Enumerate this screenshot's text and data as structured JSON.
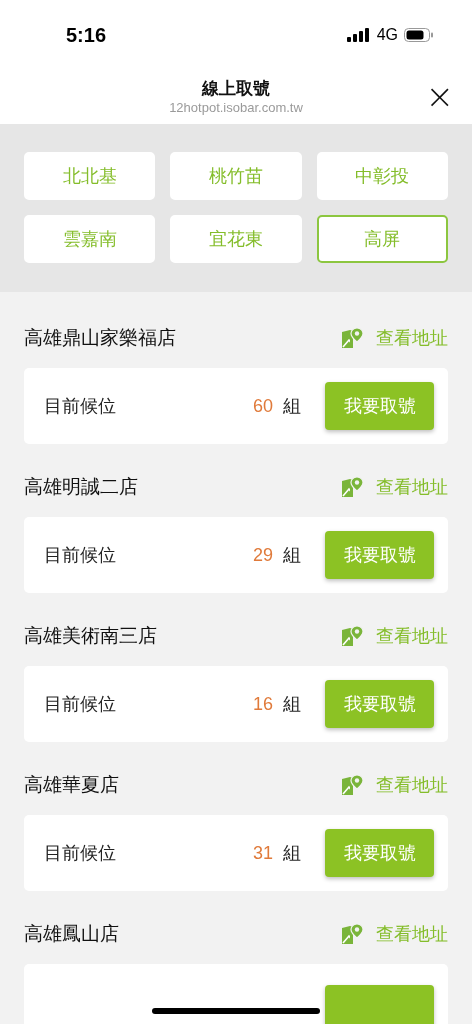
{
  "status_bar": {
    "time": "5:16",
    "network": "4G"
  },
  "header": {
    "title": "線上取號",
    "url": "12hotpot.isobar.com.tw",
    "close": "×"
  },
  "regions": [
    {
      "label": "北北基",
      "selected": false
    },
    {
      "label": "桃竹苗",
      "selected": false
    },
    {
      "label": "中彰投",
      "selected": false
    },
    {
      "label": "雲嘉南",
      "selected": false
    },
    {
      "label": "宜花東",
      "selected": false
    },
    {
      "label": "高屏",
      "selected": true
    }
  ],
  "stores": [
    {
      "name": "高雄鼎山家樂福店",
      "address_link": "查看地址",
      "waiting_label": "目前候位",
      "count": "60",
      "unit": "組",
      "button": "我要取號"
    },
    {
      "name": "高雄明誠二店",
      "address_link": "查看地址",
      "waiting_label": "目前候位",
      "count": "29",
      "unit": "組",
      "button": "我要取號"
    },
    {
      "name": "高雄美術南三店",
      "address_link": "查看地址",
      "waiting_label": "目前候位",
      "count": "16",
      "unit": "組",
      "button": "我要取號"
    },
    {
      "name": "高雄華夏店",
      "address_link": "查看地址",
      "waiting_label": "目前候位",
      "count": "31",
      "unit": "組",
      "button": "我要取號"
    },
    {
      "name": "高雄鳳山店",
      "address_link": "查看地址"
    }
  ]
}
